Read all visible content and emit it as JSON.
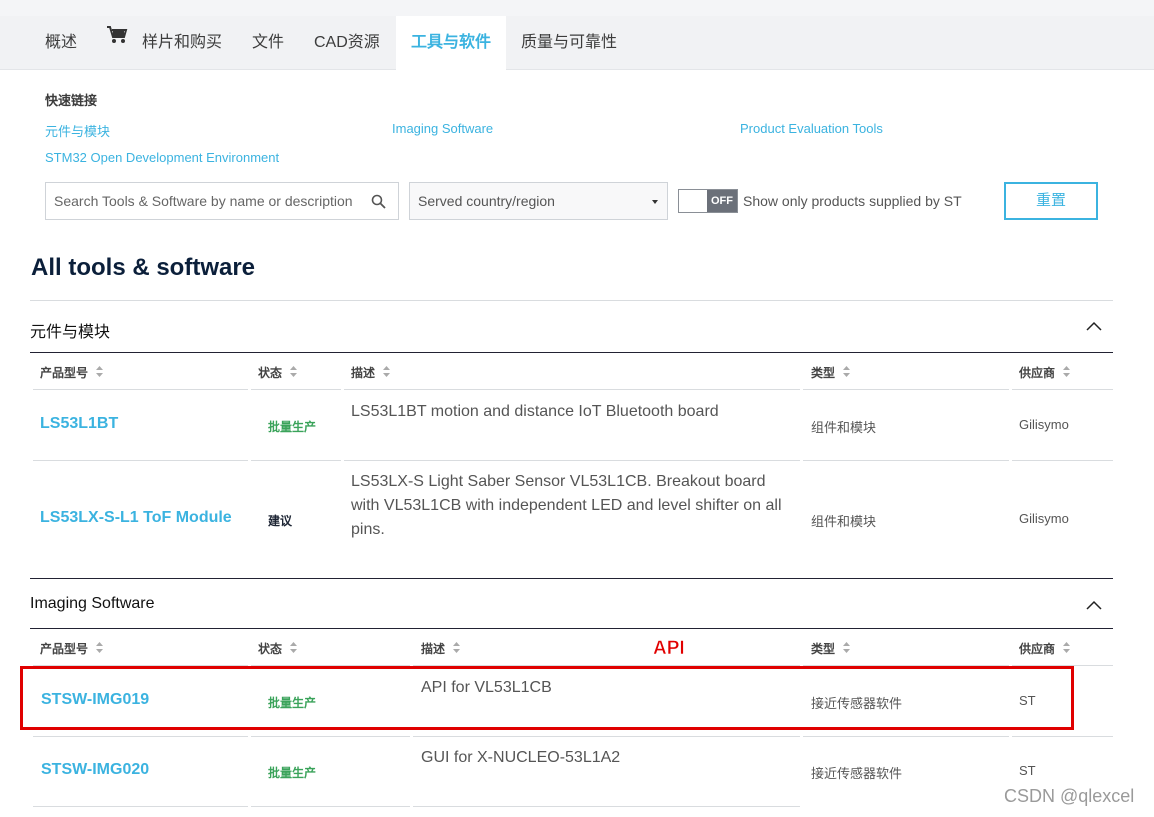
{
  "tabs": [
    {
      "label": "概述",
      "active": false
    },
    {
      "label": "样片和购买",
      "active": false,
      "icon": "cart-icon"
    },
    {
      "label": "文件",
      "active": false
    },
    {
      "label": "CAD资源",
      "active": false
    },
    {
      "label": "工具与软件",
      "active": true
    },
    {
      "label": "质量与可靠性",
      "active": false
    }
  ],
  "quick_links": {
    "title": "快速链接",
    "items": [
      "元件与模块",
      "Imaging Software",
      "Product Evaluation Tools",
      "STM32 Open Development Environment"
    ]
  },
  "filters": {
    "search_placeholder": "Search Tools & Software by name or description",
    "country_select": "Served country/region",
    "toggle_state": "OFF",
    "toggle_label": "Show only products supplied by ST",
    "reset_label": "重置"
  },
  "page_title": "All tools & software",
  "table_headers": {
    "part": "产品型号",
    "status": "状态",
    "desc": "描述",
    "type": "类型",
    "supplier": "供应商"
  },
  "sections": [
    {
      "title": "元件与模块",
      "rows": [
        {
          "part": "LS53L1BT",
          "status": "批量生产",
          "desc": "LS53L1BT motion and distance IoT Bluetooth board",
          "type": "组件和模块",
          "supplier": "Gilisymo"
        },
        {
          "part": "LS53LX-S-L1 ToF Module",
          "status": "建议",
          "desc": "LS53LX-S Light Saber Sensor VL53L1CB. Breakout board with VL53L1CB with independent LED and level shifter on all pins.",
          "type": "组件和模块",
          "supplier": "Gilisymo"
        }
      ]
    },
    {
      "title": "Imaging Software",
      "rows": [
        {
          "part": "STSW-IMG019",
          "status": "批量生产",
          "desc": "API for VL53L1CB",
          "type": "接近传感器软件",
          "supplier": "ST"
        },
        {
          "part": "STSW-IMG020",
          "status": "批量生产",
          "desc": "GUI for X-NUCLEO-53L1A2",
          "type": "接近传感器软件",
          "supplier": "ST"
        }
      ]
    }
  ],
  "annotation": "API",
  "watermark": "CSDN @qlexcel",
  "colors": {
    "accent": "#3bb3e0",
    "status_green": "#3aa35a",
    "highlight_red": "#e00000"
  }
}
